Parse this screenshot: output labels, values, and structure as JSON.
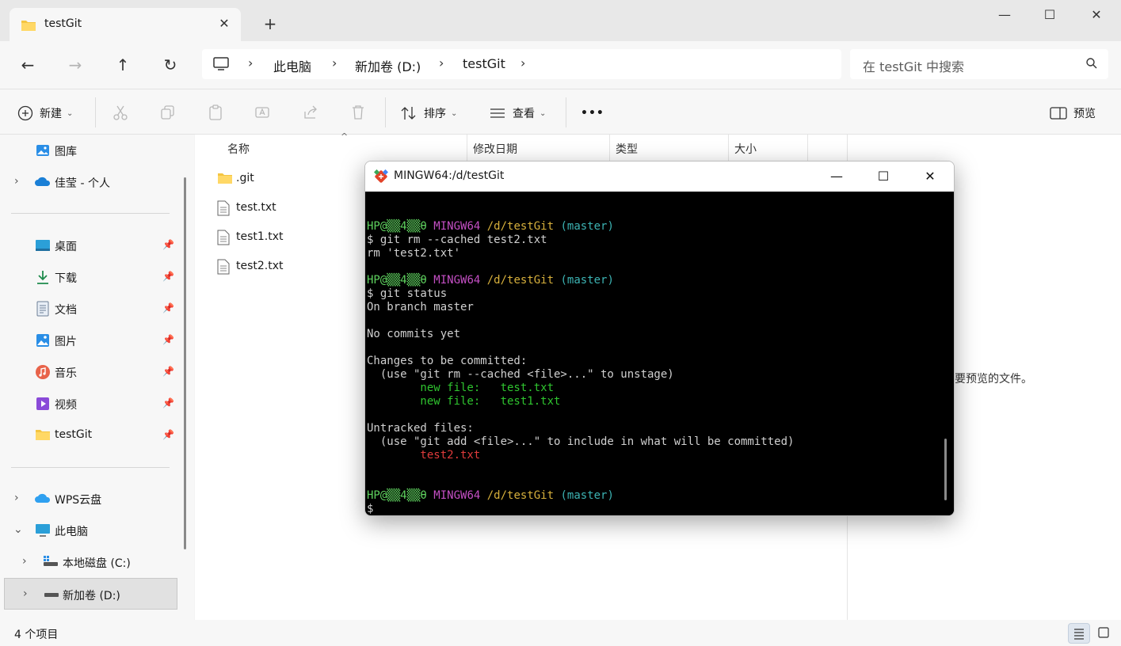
{
  "tab": {
    "title": "testGit",
    "close": "✕",
    "new": "+"
  },
  "window": {
    "minimize": "—",
    "maximize": "☐",
    "close": "✕"
  },
  "nav_buttons": {
    "back": "←",
    "forward": "→",
    "up": "↑",
    "refresh": "↻"
  },
  "breadcrumb": {
    "items": [
      "此电脑",
      "新加卷 (D:)",
      "testGit"
    ]
  },
  "search": {
    "placeholder": "在 testGit 中搜索"
  },
  "commands": {
    "new": "新建",
    "sort": "排序",
    "view": "查看",
    "more": "•••",
    "preview": "预览"
  },
  "sidebar": {
    "items": [
      {
        "label": "图库"
      },
      {
        "label": "佳莹 - 个人"
      },
      {
        "label": "桌面"
      },
      {
        "label": "下载"
      },
      {
        "label": "文档"
      },
      {
        "label": "图片"
      },
      {
        "label": "音乐"
      },
      {
        "label": "视频"
      },
      {
        "label": "testGit"
      },
      {
        "label": "WPS云盘"
      },
      {
        "label": "此电脑"
      },
      {
        "label": "本地磁盘 (C:)"
      },
      {
        "label": "新加卷 (D:)"
      }
    ]
  },
  "columns": {
    "name": "名称",
    "modified": "修改日期",
    "type": "类型",
    "size": "大小"
  },
  "files": [
    {
      "name": ".git"
    },
    {
      "name": "test.txt"
    },
    {
      "name": "test1.txt"
    },
    {
      "name": "test2.txt"
    }
  ],
  "preview_text": "要预览的文件。",
  "status": {
    "count": "4 个项目"
  },
  "terminal": {
    "title": "MINGW64:/d/testGit",
    "prompt_user": "HP@▒▒4▒▒θ",
    "prompt_env": "MINGW64",
    "prompt_path": "/d/testGit",
    "prompt_branch": "(master)",
    "cmd1": "$ git rm --cached test2.txt",
    "out1": "rm 'test2.txt'",
    "cmd2": "$ git status",
    "out2a": "On branch master",
    "out2b": "No commits yet",
    "out2c": "Changes to be committed:",
    "out2d": "  (use \"git rm --cached <file>...\" to unstage)",
    "staged1": "        new file:   test.txt",
    "staged2": "        new file:   test1.txt",
    "out2e": "Untracked files:",
    "out2f": "  (use \"git add <file>...\" to include in what will be committed)",
    "untracked1": "        test2.txt",
    "cursor": "$"
  }
}
